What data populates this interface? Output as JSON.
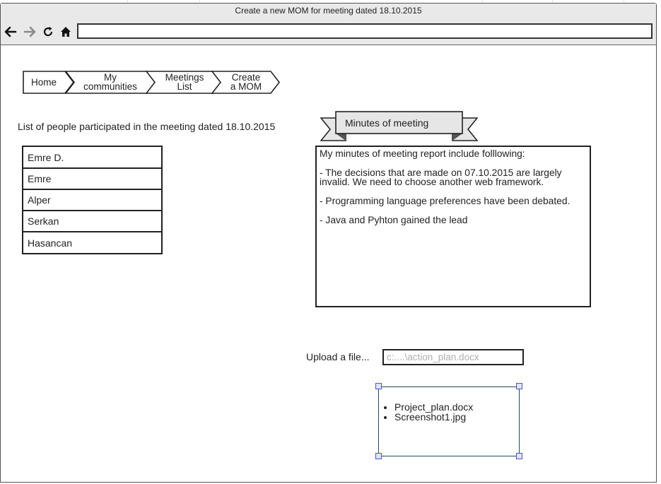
{
  "window": {
    "title": "Create a new MOM for meeting dated 18.10.2015",
    "address_value": ""
  },
  "toolbar": {
    "back_icon": "back-arrow-icon",
    "forward_icon": "forward-arrow-icon",
    "reload_icon": "reload-icon",
    "home_icon": "home-icon"
  },
  "breadcrumb": [
    {
      "label": "Home"
    },
    {
      "label": "My\ncommunities"
    },
    {
      "label": "Meetings\nList"
    },
    {
      "label": "Create\na MOM"
    }
  ],
  "participants": {
    "heading": "List of people participated in the meeting dated 18.10.2015",
    "people": [
      "Emre D.",
      "Emre",
      "Alper",
      "Serkan",
      "Hasancan"
    ]
  },
  "minutes": {
    "ribbon_label": "Minutes of meeting",
    "lines": [
      "My minutes of meeting report include folllowing:",
      "- The decisions that are made on 07.10.2015 are largely invalid. We need to choose another web framework.",
      "- Programming language preferences have been debated.",
      "- Java and Pyhton gained the lead"
    ]
  },
  "upload": {
    "label": "Upload a file...",
    "placeholder": "c:....\\action_plan.docx",
    "value": ""
  },
  "files": [
    "Project_plan.docx",
    "Screenshot1.jpg"
  ],
  "colors": {
    "titlebar": "#e9e9e9",
    "ribbon_fill": "#e6e6e6",
    "files_border": "#1d4d5c",
    "handle_fill": "#dfe3ff",
    "handle_border": "#4a55c8"
  }
}
